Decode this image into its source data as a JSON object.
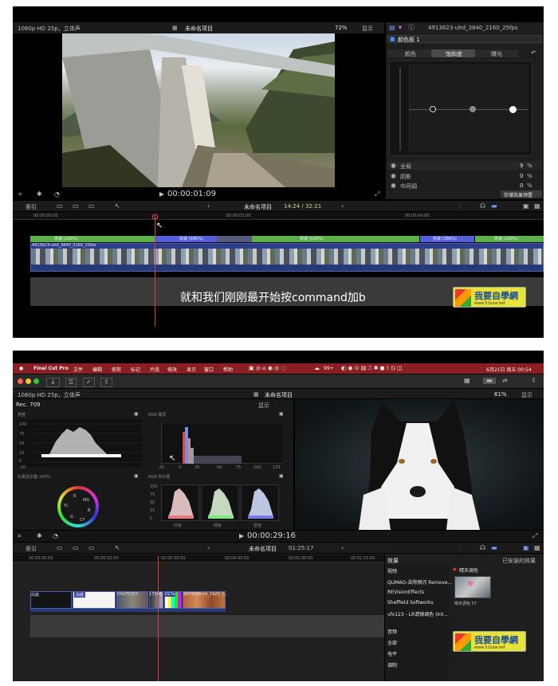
{
  "top": {
    "viewer": {
      "format": "1080p HD 25p，立体声",
      "project": "未命名项目",
      "zoom": "72%",
      "display": "显示",
      "timecode": "00:00:01:09"
    },
    "inspector": {
      "clip_name": "4913623-uhd_3840_2160_25fps",
      "color_board": "颜色板 1",
      "tabs": [
        "颜色",
        "饱和度",
        "曝光"
      ],
      "rows": [
        {
          "label": "全局",
          "value": "9",
          "unit": "%"
        },
        {
          "label": "阴影",
          "value": "0",
          "unit": "%"
        },
        {
          "label": "中间调",
          "value": "0",
          "unit": "%"
        }
      ],
      "save_button": "存储效果预置"
    },
    "timeline": {
      "index": "索引",
      "project": "未命名项目",
      "duration": "14:24 / 32:21",
      "ruler": [
        "00:00:00:00",
        "00:00:02:00",
        "00:00:04:00"
      ],
      "speed": [
        "常速 (100%)",
        "快速 (386%)",
        "常速 (100%)",
        "快速 (386%)",
        "常速 (100%)"
      ],
      "clip": "4913623-uhd_3840_2160_25fps"
    },
    "subtitle": "就和我们刚刚最开始按command加b",
    "watermark": {
      "title": "我要自學網",
      "url": "www.51zxw.net"
    }
  },
  "bottom": {
    "menubar": {
      "app": "Final Cut Pro",
      "items": [
        "文件",
        "编辑",
        "修剪",
        "标记",
        "片段",
        "修改",
        "显示",
        "窗口",
        "帮助"
      ],
      "battery": "99+",
      "datetime": "6月21日 周五 00:54"
    },
    "viewer": {
      "format": "1080p HD 25p，立体声",
      "project": "未命名项目",
      "zoom": "61%",
      "display": "显示",
      "timecode": "00:00:29:16"
    },
    "scopes": {
      "rec": "Rec. 709",
      "display": "显示",
      "luma": {
        "title": "亮度",
        "ticks": [
          "100",
          "75",
          "50",
          "25",
          "0",
          "-20"
        ]
      },
      "parade_top": {
        "title": "RGB 叠层",
        "ticks": [
          "-25",
          "0",
          "25",
          "50",
          "75",
          "100",
          "125"
        ]
      },
      "vectorscope": {
        "title": "矢量显示器 100%",
        "labels": [
          "R",
          "MG",
          "YL",
          "B",
          "G",
          "CY"
        ]
      },
      "parade": {
        "title": "RGB 列示图",
        "ticks": [
          "100",
          "75",
          "50",
          "25",
          "0"
        ],
        "channels": [
          "红色",
          "绿色",
          "蓝色"
        ]
      }
    },
    "timeline": {
      "index": "索引",
      "project": "未命名项目",
      "duration": "01:25:17",
      "ruler": [
        "00:00:00:00",
        "00:00:15:00",
        "00:00:30:00",
        "00:00:45:00",
        "00:01:00:00",
        "00:01:15:00"
      ],
      "clips": [
        "白底",
        "白底",
        "DSCF0727",
        "17186",
        "017a",
        "8474586-hd_1920_1..."
      ]
    },
    "effects": {
      "title": "效果",
      "installed": "已安装的效果",
      "categories": [
        "视频",
        "QUMAO-去除频闪 Remove...",
        "REVisionEffects",
        "Sheffield Softworks",
        "vfx123 - LR滤镜调色 (Int...",
        "音频",
        "全部",
        "电平",
        "调制"
      ],
      "preset_header": "晴天调色",
      "preset_item": "晴天调色 57"
    },
    "watermark": {
      "title": "我要自學網",
      "url": "www.51zxw.net"
    }
  }
}
